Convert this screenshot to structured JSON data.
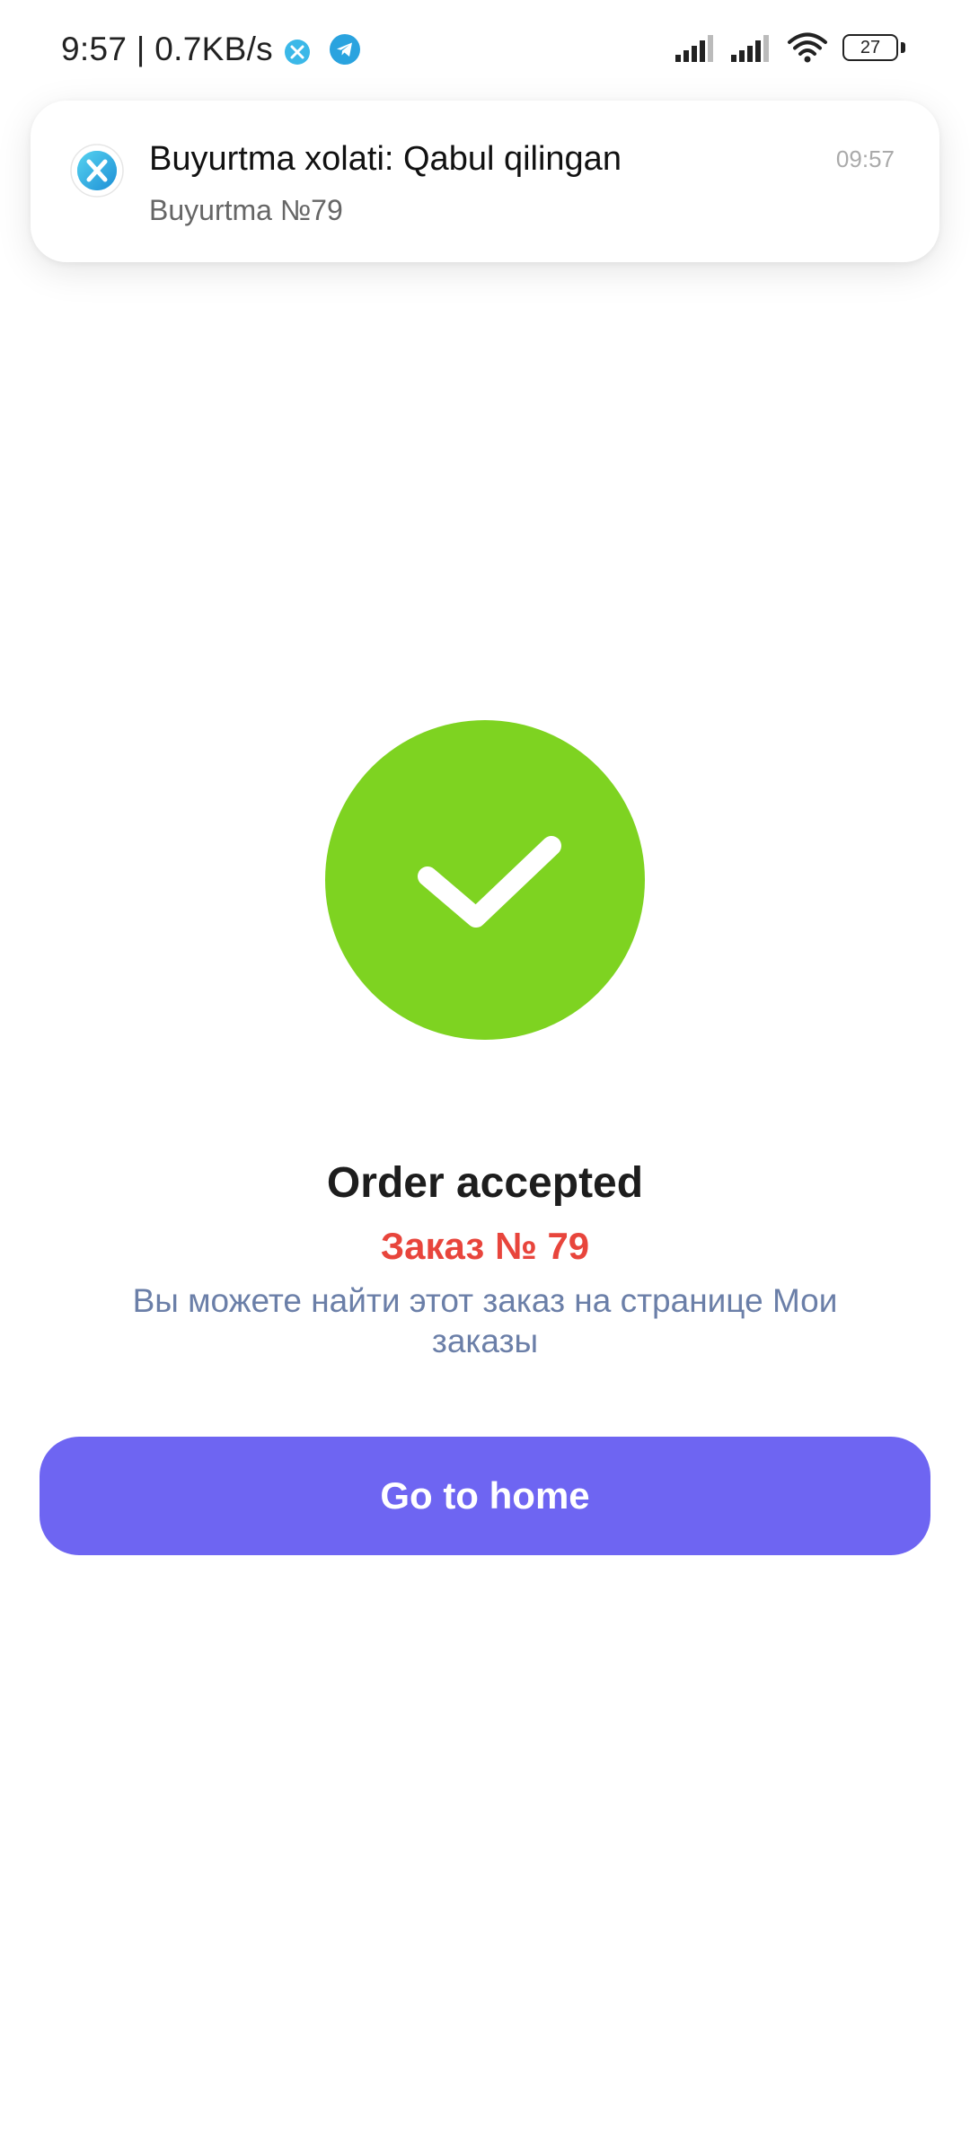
{
  "status_bar": {
    "time_and_speed": "9:57 | 0.7KB/s",
    "battery_level": "27",
    "icons": [
      "app-icon",
      "telegram-icon",
      "signal-icon",
      "signal-icon",
      "wifi-icon",
      "battery-icon"
    ]
  },
  "notification": {
    "title": "Buyurtma xolati: Qabul qilingan",
    "body": "Buyurtma №79",
    "time": "09:57",
    "icon": "app-icon"
  },
  "order": {
    "status_icon": "check-icon",
    "title": "Order accepted",
    "number": "Заказ № 79",
    "info": "Вы можете найти этот заказ на странице Мои заказы",
    "button_label": "Go to home"
  },
  "colors": {
    "success": "#7ed321",
    "order_number": "#e8453c",
    "info_text": "#6b7fa8",
    "button": "#6e65f2"
  }
}
